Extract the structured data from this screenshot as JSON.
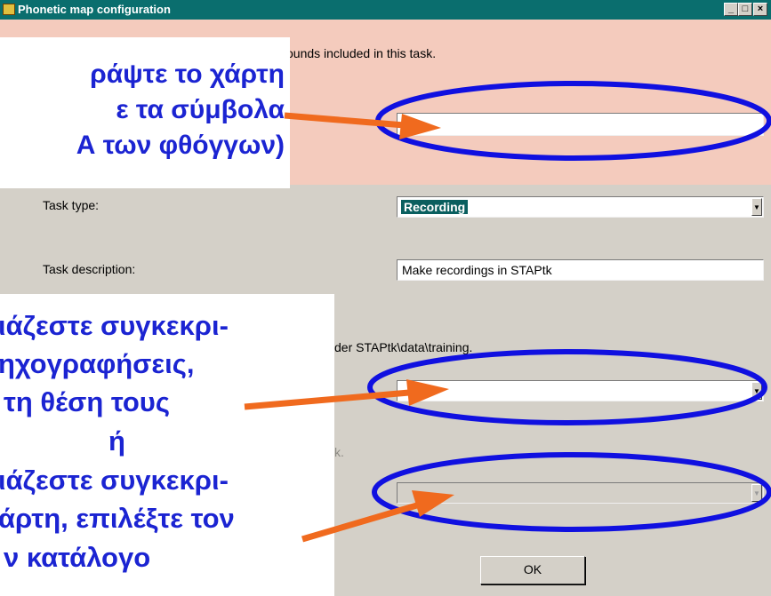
{
  "window": {
    "title": "Phonetic map configuration",
    "controls": [
      "_",
      "□",
      "×"
    ]
  },
  "instruction_top": "ounds included in this task.",
  "task_type": {
    "label": "Task type:",
    "value": "Recording"
  },
  "task_description": {
    "label": "Task description:",
    "value": "Make recordings in STAPtk"
  },
  "data_note": "der STAPtk\\data\\training.",
  "map_note": "k.",
  "ok_label": "OK",
  "callout1": {
    "lines": [
      "ράψτε το χάρτη",
      "ε τα σύμβολα",
      "Α των φθόγγων)"
    ]
  },
  "callout2": {
    "lines": [
      "ιάζεστε συγκεκρι-",
      "ηχογραφήσεις,",
      "τη θέση τους",
      "ή",
      "ιάζεστε συγκεκρι-",
      "άρτη, επιλέξτε τον",
      "ν κατάλογο"
    ]
  },
  "colors": {
    "ellipse": "#1010e0",
    "arrow": "#f06a1e",
    "callout_text": "#1b24d2",
    "titlebar": "#0a6e6e",
    "pink_panel": "#f4cbbd"
  }
}
